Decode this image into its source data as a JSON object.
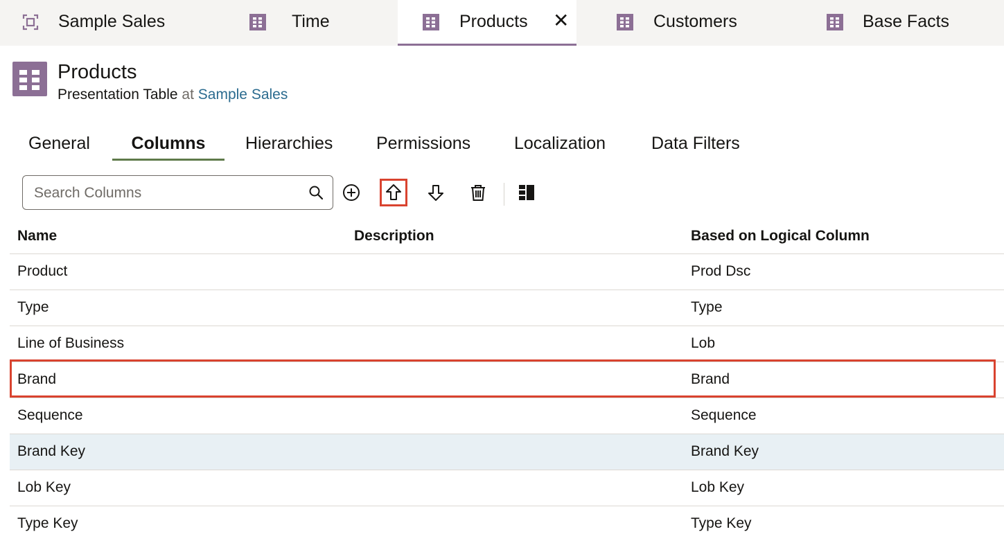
{
  "doc_tabs": [
    {
      "label": "Sample Sales",
      "icon": "subject-area-icon"
    },
    {
      "label": "Time",
      "icon": "table-icon"
    },
    {
      "label": "Products",
      "icon": "table-icon",
      "active": true,
      "close_symbol": "✕"
    },
    {
      "label": "Customers",
      "icon": "table-icon"
    },
    {
      "label": "Base Facts",
      "icon": "table-icon"
    }
  ],
  "header": {
    "title": "Products",
    "type_label": "Presentation Table",
    "at_label": "at",
    "parent_link": "Sample Sales"
  },
  "subtabs": [
    {
      "label": "General"
    },
    {
      "label": "Columns",
      "active": true
    },
    {
      "label": "Hierarchies"
    },
    {
      "label": "Permissions"
    },
    {
      "label": "Localization"
    },
    {
      "label": "Data Filters"
    }
  ],
  "toolbar": {
    "search_placeholder": "Search Columns",
    "search_value": "",
    "buttons": [
      "add-icon",
      "move-up-icon",
      "move-down-icon",
      "delete-icon",
      "column-layout-icon"
    ],
    "highlighted_button": "move-up-icon"
  },
  "table": {
    "headers": [
      "Name",
      "Description",
      "Based on Logical Column"
    ],
    "rows": [
      {
        "name": "Product",
        "description": "",
        "logical": "Prod Dsc"
      },
      {
        "name": "Type",
        "description": "",
        "logical": "Type"
      },
      {
        "name": "Line of Business",
        "description": "",
        "logical": "Lob"
      },
      {
        "name": "Brand",
        "description": "",
        "logical": "Brand"
      },
      {
        "name": "Sequence",
        "description": "",
        "logical": "Sequence"
      },
      {
        "name": "Brand Key",
        "description": "",
        "logical": "Brand Key"
      },
      {
        "name": "Lob Key",
        "description": "",
        "logical": "Lob Key"
      },
      {
        "name": "Type Key",
        "description": "",
        "logical": "Type Key"
      }
    ],
    "selected_row": "Brand Key",
    "highlighted_row": "Brand"
  },
  "colors": {
    "accent_purple": "#8c6f95",
    "active_subtab_underline": "#5e7a4a",
    "highlight_red": "#d9432f",
    "link_blue": "#2b6b8f",
    "selected_row_bg": "#e8f0f4"
  }
}
